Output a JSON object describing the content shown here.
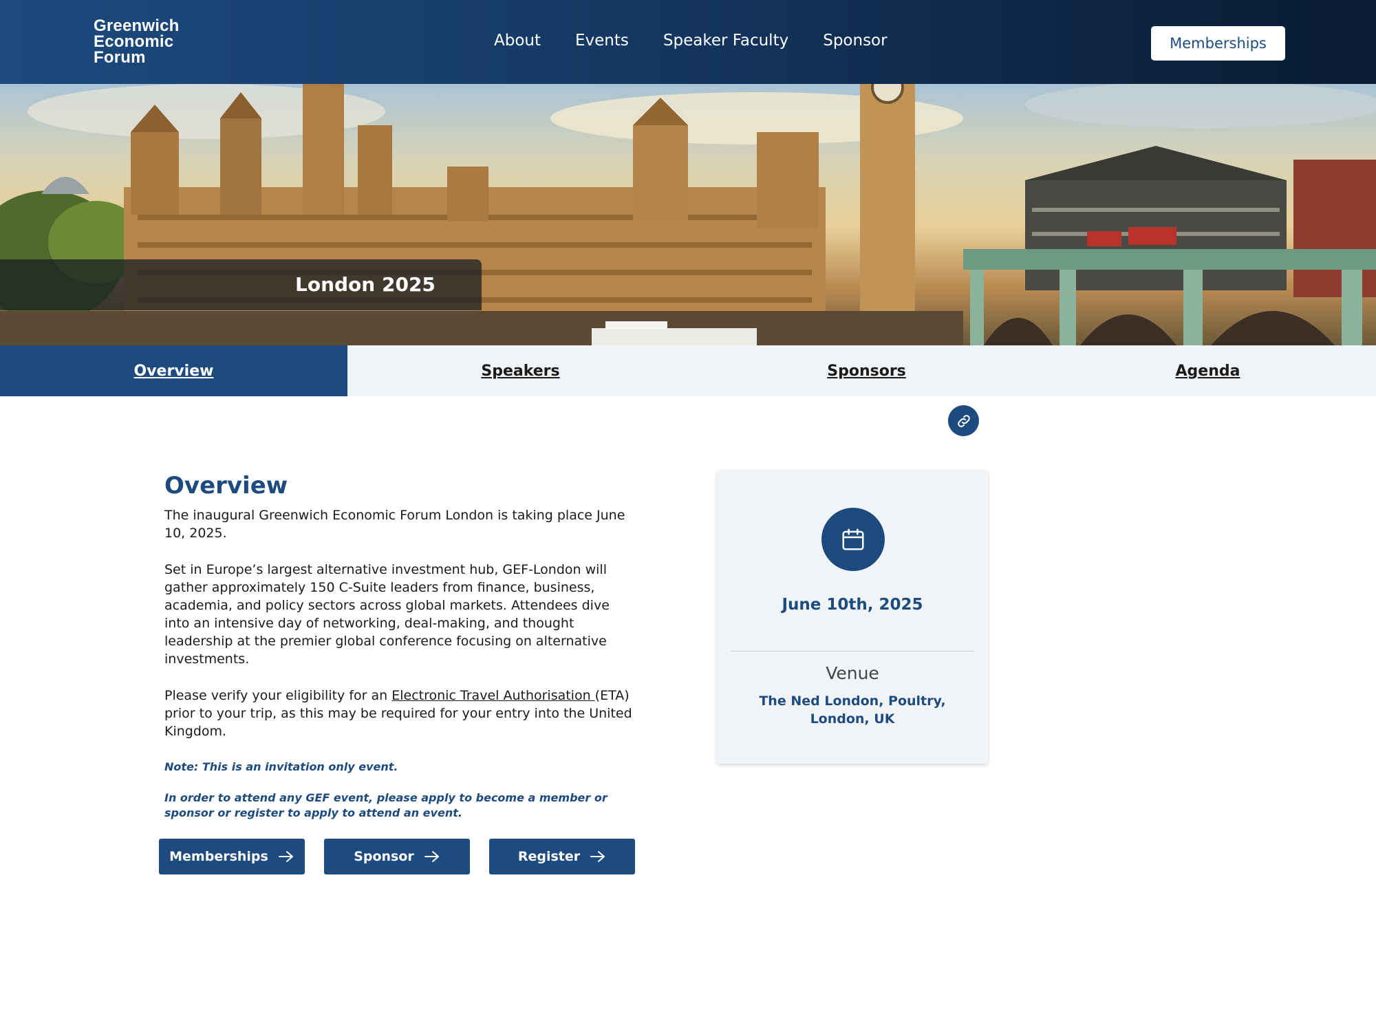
{
  "header": {
    "logo_lines": [
      "Greenwich",
      "Economic",
      "Forum"
    ],
    "nav": [
      "About",
      "Events",
      "Speaker Faculty",
      "Sponsor"
    ],
    "memberships_label": "Memberships"
  },
  "hero": {
    "title": "London 2025"
  },
  "tabs": [
    {
      "label": "Overview",
      "active": true
    },
    {
      "label": "Speakers",
      "active": false
    },
    {
      "label": "Sponsors",
      "active": false
    },
    {
      "label": "Agenda",
      "active": false
    }
  ],
  "overview": {
    "heading": "Overview",
    "para_1": "The inaugural Greenwich Economic Forum London is taking place June 10, 2025.",
    "para_2": "Set in Europe’s largest alternative investment hub, GEF-London will gather approximately 150 C-Suite leaders from finance, business, academia, and policy sectors across global markets. Attendees dive into an intensive day of networking, deal-making, and thought leadership at the premier global conference focusing on alternative investments.",
    "para_3_before": "Please verify your eligibility for an ",
    "para_3_link": "Electronic Travel Authorisation ",
    "para_3_after": "(ETA) prior to your trip, as this may be required for your entry into the United Kingdom.",
    "note_1": "Note:  This is an invitation only event.",
    "note_2": "In order to attend any GEF event, please apply to become a member or sponsor or register to apply to attend an event.",
    "buttons": [
      "Memberships",
      "Sponsor",
      "Register"
    ]
  },
  "event_card": {
    "date": "June 10th, 2025",
    "venue_label": "Venue",
    "venue": "The Ned London, Poultry, London, UK"
  },
  "colors": {
    "primary": "#1d4b80",
    "tab_bar": "#f1f4f7",
    "header_dark": "#0a1b33"
  },
  "icons": {
    "link": "link-icon",
    "calendar": "calendar-icon",
    "arrow": "arrow-right-icon"
  }
}
